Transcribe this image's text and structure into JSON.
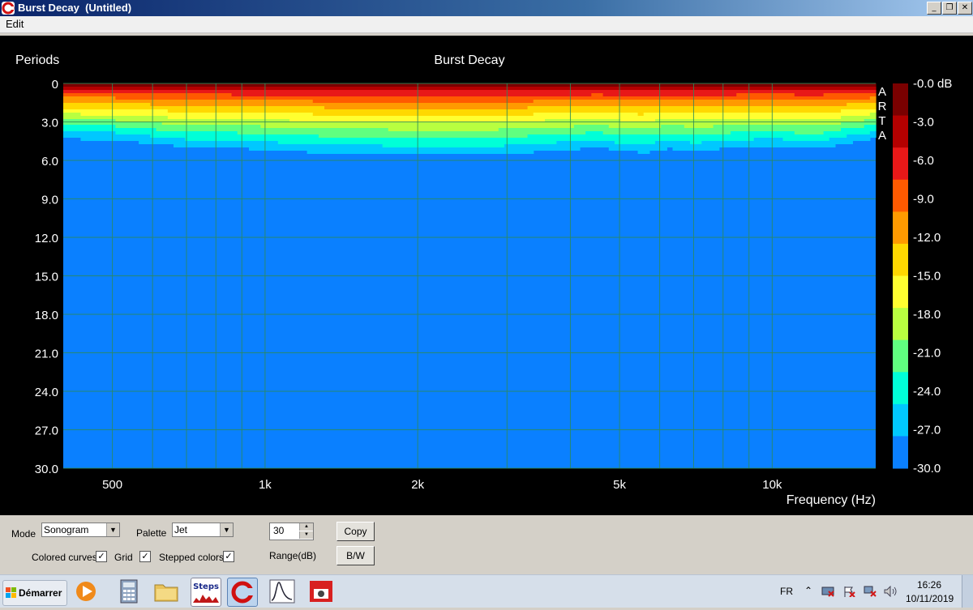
{
  "window": {
    "title": "Burst Decay  (Untitled)",
    "buttons": {
      "minimize": "_",
      "restore": "❐",
      "close": "✕"
    }
  },
  "menu": {
    "edit": "Edit"
  },
  "chart_data": {
    "type": "heatmap",
    "title": "Burst Decay",
    "xlabel": "Frequency (Hz)",
    "ylabel": "Periods",
    "x_scale": "log",
    "xlim": [
      400,
      16000
    ],
    "x_ticks": [
      {
        "value": 500,
        "label": "500"
      },
      {
        "value": 1000,
        "label": "1k"
      },
      {
        "value": 2000,
        "label": "2k"
      },
      {
        "value": 5000,
        "label": "5k"
      },
      {
        "value": 10000,
        "label": "10k"
      }
    ],
    "x_gridlines": [
      500,
      600,
      700,
      800,
      900,
      1000,
      2000,
      3000,
      4000,
      5000,
      6000,
      7000,
      8000,
      9000,
      10000
    ],
    "ylim": [
      0,
      30
    ],
    "y_ticks": [
      "0",
      "3.0",
      "6.0",
      "9.0",
      "12.0",
      "15.0",
      "18.0",
      "21.0",
      "24.0",
      "27.0",
      "30.0"
    ],
    "colorbar": {
      "labels": [
        "-0.0 dB",
        "-3.0",
        "-6.0",
        "-9.0",
        "-12.0",
        "-15.0",
        "-18.0",
        "-21.0",
        "-24.0",
        "-27.0",
        "-30.0"
      ],
      "range_db": 30,
      "colors": [
        "#7a0000",
        "#b40000",
        "#e81818",
        "#ff5a00",
        "#ff9a00",
        "#ffd800",
        "#ffff30",
        "#b8ff40",
        "#60ff80",
        "#00ffd8",
        "#00c8ff",
        "#0a80ff"
      ]
    },
    "watermark": [
      "A",
      "R",
      "T",
      "A"
    ],
    "grid": true,
    "decay": {
      "freq": [
        400,
        450,
        500,
        560,
        630,
        710,
        800,
        900,
        1000,
        1120,
        1250,
        1400,
        1600,
        1800,
        2000,
        2240,
        2500,
        2800,
        3150,
        3550,
        4000,
        4500,
        5000,
        5600,
        6300,
        7100,
        8000,
        9000,
        10000,
        11200,
        12500,
        14000,
        16000
      ],
      "periods_to_minus30dB": [
        4.3,
        4.4,
        4.4,
        4.6,
        4.8,
        5.0,
        5.0,
        5.1,
        5.2,
        5.3,
        5.4,
        5.5,
        5.5,
        5.6,
        5.6,
        5.6,
        5.6,
        5.6,
        5.5,
        5.3,
        5.2,
        5.0,
        5.3,
        5.4,
        5.1,
        5.3,
        5.1,
        5.0,
        4.9,
        5.1,
        5.1,
        4.7,
        4.3
      ]
    }
  },
  "controls": {
    "mode_label": "Mode",
    "mode_value": "Sonogram",
    "palette_label": "Palette",
    "palette_value": "Jet",
    "range_value": "30",
    "range_label": "Range(dB)",
    "copy_label": "Copy",
    "bw_label": "B/W",
    "colored_curves_label": "Colored curves",
    "colored_curves_checked": true,
    "grid_label": "Grid",
    "grid_checked": true,
    "stepped_colors_label": "Stepped colors",
    "stepped_colors_checked": true,
    "check_mark": "✓"
  },
  "taskbar": {
    "start_label": "Démarrer",
    "steps_label": "Steps",
    "lang": "FR",
    "time": "16:26",
    "date": "10/11/2019",
    "chevron": "⌃"
  }
}
